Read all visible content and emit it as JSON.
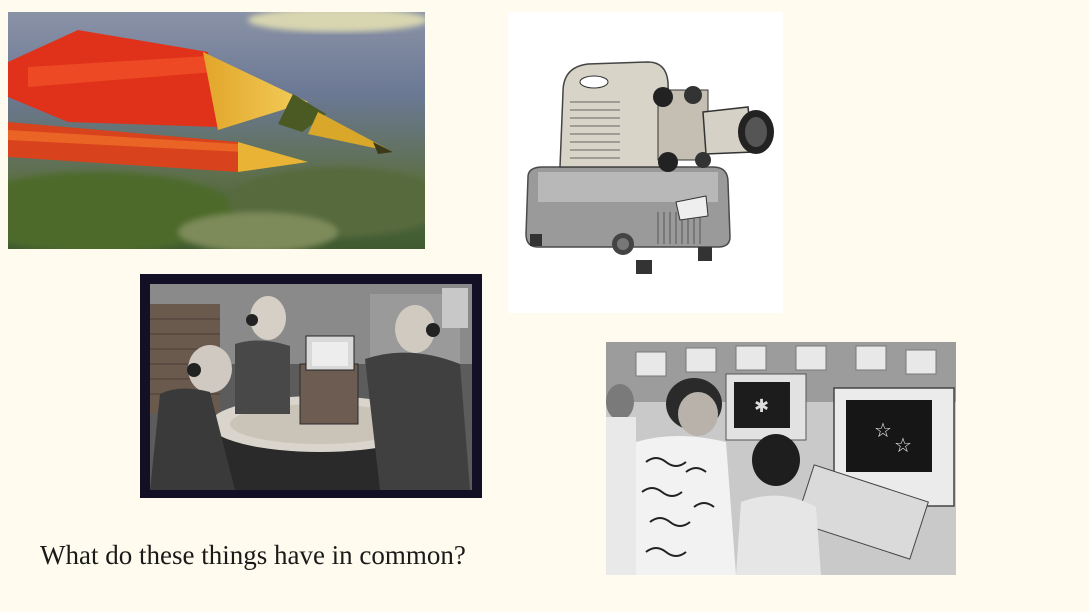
{
  "slide": {
    "question": "What do these things have in common?"
  },
  "images": [
    {
      "name": "pencils",
      "subject": "red and yellow pencil tips"
    },
    {
      "name": "projector",
      "subject": "vintage slide projector"
    },
    {
      "name": "radio",
      "subject": "children listening to a radio with headphones"
    },
    {
      "name": "computers",
      "subject": "teacher and child at classroom computers"
    }
  ]
}
